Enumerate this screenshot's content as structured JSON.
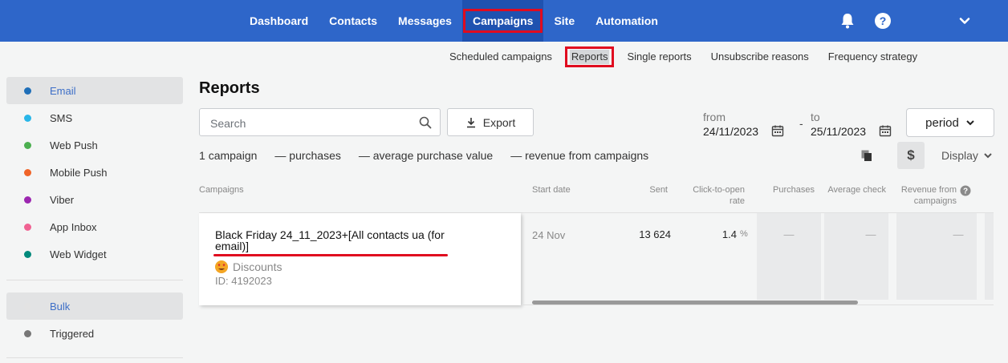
{
  "topnav": {
    "items": [
      "Dashboard",
      "Contacts",
      "Messages",
      "Campaigns",
      "Site",
      "Automation"
    ],
    "active": "Campaigns",
    "help_label": "?"
  },
  "subnav": {
    "items": [
      "Scheduled campaigns",
      "Reports",
      "Single reports",
      "Unsubscribe reasons",
      "Frequency strategy"
    ],
    "active": "Reports"
  },
  "sidebar": {
    "channels": [
      {
        "label": "Email",
        "color": "#1f6fb8",
        "active": true
      },
      {
        "label": "SMS",
        "color": "#29b6e8",
        "active": false
      },
      {
        "label": "Web Push",
        "color": "#4caf50",
        "active": false
      },
      {
        "label": "Mobile Push",
        "color": "#f06428",
        "active": false
      },
      {
        "label": "Viber",
        "color": "#9c27b0",
        "active": false
      },
      {
        "label": "App Inbox",
        "color": "#f06292",
        "active": false
      },
      {
        "label": "Web Widget",
        "color": "#00897b",
        "active": false
      }
    ],
    "types": [
      {
        "label": "Bulk",
        "color": "#e3e3e3",
        "active": true
      },
      {
        "label": "Triggered",
        "color": "#777777",
        "active": false
      }
    ]
  },
  "main": {
    "title": "Reports",
    "search_placeholder": "Search",
    "export_label": "Export",
    "from_label": "from",
    "from_date": "24/11/2023",
    "to_label": "to",
    "to_date": "25/11/2023",
    "date_separator": "-",
    "period_label": "period",
    "stats": {
      "campaign_count": "1",
      "campaign_word": "campaign",
      "purchases": "— purchases",
      "avg_purchase": "— average purchase value",
      "revenue": "— revenue from campaigns"
    },
    "currency_symbol": "$",
    "display_label": "Display"
  },
  "table": {
    "headers": {
      "campaigns": "Campaigns",
      "start_date": "Start date",
      "sent": "Sent",
      "cto_rate": "Click-to-open rate",
      "purchases": "Purchases",
      "average_check": "Average check",
      "revenue": "Revenue from campaigns"
    },
    "rows": [
      {
        "name": "Black Friday 24_11_2023+[All contacts ua (for email)]",
        "tag": "Discounts",
        "id": "ID: 4192023",
        "start_date": "24 Nov",
        "sent": "13 624",
        "cto_rate": "1.4",
        "cto_unit": "%",
        "purchases": "—",
        "average_check": "—",
        "revenue": "—"
      }
    ]
  },
  "colors": {
    "topbar": "#2e66c9",
    "highlight": "#e00b1f",
    "active_text": "#3d6fc7"
  }
}
